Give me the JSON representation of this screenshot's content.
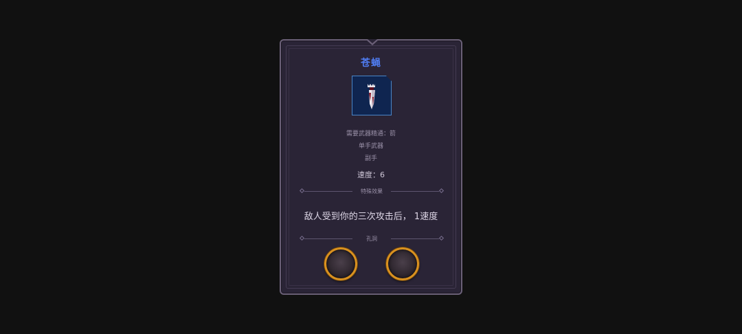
{
  "item": {
    "name": "苍蝇",
    "name_color": "#4f7cf0",
    "icon": "dagger-icon",
    "requirement": "需要武器精通：箭",
    "weapon_type": "单手武器",
    "slot": "副手",
    "speed": "速度：6"
  },
  "special": {
    "header": "特殊效果",
    "effect": "敌人受到你的三次攻击后， 1速度"
  },
  "sockets": {
    "header": "孔洞",
    "count": 2
  }
}
